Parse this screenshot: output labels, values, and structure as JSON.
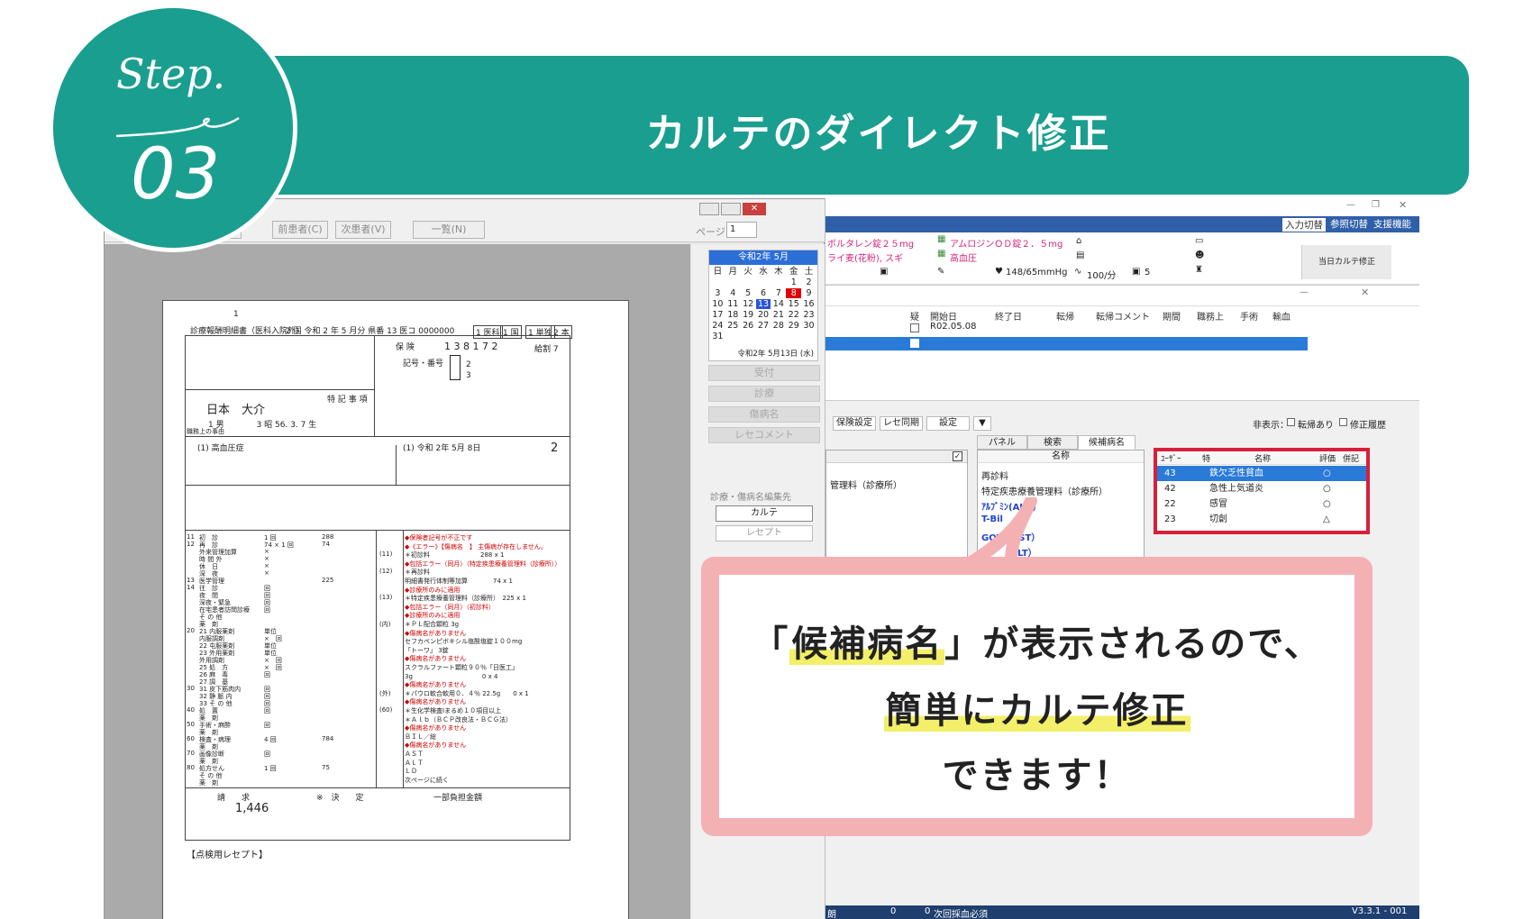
{
  "header": {
    "step_word": "Step.",
    "step_number": "03",
    "title": "カルテのダイレクト修正",
    "brand_color": "#1a9e8f"
  },
  "receipt_window": {
    "toolbar": {
      "back_button": "る",
      "prev_patient_button": "前患者(C)",
      "next_patient_button": "次患者(V)",
      "list_button": "一覧(N)",
      "page_label": "ページ",
      "page_value": "1"
    },
    "document": {
      "page_num": "1",
      "heading": "診療報酬明細書（医科入院外）",
      "era_date": "2 国  令和  2  年  5  月分  県番 13 医コ 0000000",
      "type_cells": [
        "1 医科",
        "1 国",
        "1 単独",
        "2 本"
      ],
      "insurer_label": "保 険",
      "insurer_number": "1  3  8  1  7  2",
      "benefit_ratio": "給割 7",
      "symbol_label": "記号・番号",
      "patient_name": "日本　大介",
      "patient_sex_birth": "1 男　　　　3 昭 56.  3.  7 生",
      "special_label": "特 記 事 項",
      "occupation_label": "職務上の事由",
      "disease_name": "(1) 高血圧症",
      "start_date": "(1) 令和  2年  5月  8日",
      "days": "2",
      "rows": [
        {
          "code": "11",
          "label": "初　診",
          "count": "1 回",
          "points": "288"
        },
        {
          "code": "12",
          "label": "再　診",
          "count": "74 ×  1 回",
          "points": "74"
        },
        {
          "code": "",
          "label": "外来管理加算",
          "count": "×",
          "points": ""
        },
        {
          "code": "",
          "label": "時 間 外",
          "count": "×",
          "points": ""
        },
        {
          "code": "",
          "label": "休　日",
          "count": "×",
          "points": ""
        },
        {
          "code": "",
          "label": "深　夜",
          "count": "×",
          "points": ""
        },
        {
          "code": "13",
          "label": "医学管理",
          "count": "",
          "points": "225"
        },
        {
          "code": "14",
          "label": "往　診",
          "count": "回",
          "points": ""
        },
        {
          "code": "",
          "label": "夜　間",
          "count": "回",
          "points": ""
        },
        {
          "code": "",
          "label": "深夜・緊急",
          "count": "回",
          "points": ""
        },
        {
          "code": "",
          "label": "在宅患者訪問診療",
          "count": "回",
          "points": ""
        },
        {
          "code": "",
          "label": "そ の 他",
          "count": "",
          "points": ""
        },
        {
          "code": "",
          "label": "薬　剤",
          "count": "",
          "points": ""
        },
        {
          "code": "20",
          "label": "21 内服薬剤",
          "count": "単位",
          "points": ""
        },
        {
          "code": "",
          "label": "内服調剤",
          "count": "×　回",
          "points": ""
        },
        {
          "code": "",
          "label": "22 屯服薬剤",
          "count": "単位",
          "points": ""
        },
        {
          "code": "",
          "label": "23 外用薬剤",
          "count": "単位",
          "points": ""
        },
        {
          "code": "",
          "label": "外用調剤",
          "count": "×　回",
          "points": ""
        },
        {
          "code": "",
          "label": "25 処　方",
          "count": "×　回",
          "points": ""
        },
        {
          "code": "",
          "label": "26 麻　毒",
          "count": "回",
          "points": ""
        },
        {
          "code": "",
          "label": "27 調　基",
          "count": "",
          "points": ""
        },
        {
          "code": "30",
          "label": "31 皮下筋肉内",
          "count": "回",
          "points": ""
        },
        {
          "code": "",
          "label": "32 静 脈 内",
          "count": "回",
          "points": ""
        },
        {
          "code": "",
          "label": "33 そ の 他",
          "count": "回",
          "points": ""
        },
        {
          "code": "40",
          "label": "処　置",
          "count": "回",
          "points": ""
        },
        {
          "code": "",
          "label": "薬　剤",
          "count": "",
          "points": ""
        },
        {
          "code": "50",
          "label": "手術・麻酔",
          "count": "回",
          "points": ""
        },
        {
          "code": "",
          "label": "薬　剤",
          "count": "",
          "points": ""
        },
        {
          "code": "60",
          "label": "検査・病理",
          "count": "4 回",
          "points": "784"
        },
        {
          "code": "",
          "label": "薬　剤",
          "count": "",
          "points": ""
        },
        {
          "code": "70",
          "label": "画像診断",
          "count": "回",
          "points": ""
        },
        {
          "code": "",
          "label": "薬　剤",
          "count": "",
          "points": ""
        },
        {
          "code": "80",
          "label": "処方せん",
          "count": "1 回",
          "points": "75"
        },
        {
          "code": "",
          "label": "そ の 他",
          "count": "",
          "points": ""
        },
        {
          "code": "",
          "label": "薬　剤",
          "count": "",
          "points": ""
        }
      ],
      "notes": [
        {
          "tag": "",
          "text": "◆保険者記号が不正です",
          "red": true
        },
        {
          "tag": "",
          "text": "◆《エラー》【傷病名　】 主傷病が存在しません。",
          "red": true
        },
        {
          "tag": "(11)",
          "text": "＊初診料　　　　　　　　288 x  1",
          "red": false
        },
        {
          "tag": "",
          "text": "◆包括エラー（同月）（特定疾患療養管理料（診療所））",
          "red": true
        },
        {
          "tag": "(12)",
          "text": "＊再診料",
          "red": false
        },
        {
          "tag": "",
          "text": "明細書発行体制等加算　　　　74 x  1",
          "red": false
        },
        {
          "tag": "",
          "text": "◆診療所のみに適用",
          "red": true
        },
        {
          "tag": "(13)",
          "text": "＊特定疾患療養管理料（診療所）　225 x  1",
          "red": false
        },
        {
          "tag": "",
          "text": "◆包括エラー（同月）（初診料）",
          "red": true
        },
        {
          "tag": "",
          "text": "◆診療所のみに適用",
          "red": true
        },
        {
          "tag": "(内)",
          "text": "＊ＰＬ配合顆粒 3g",
          "red": false
        },
        {
          "tag": "",
          "text": "◆傷病名がありません",
          "red": true
        },
        {
          "tag": "",
          "text": "セフカペンピボキシル塩酸塩錠１００mg",
          "red": false
        },
        {
          "tag": "",
          "text": "「トーワ」 3錠",
          "red": false
        },
        {
          "tag": "",
          "text": "◆傷病名がありません",
          "red": true
        },
        {
          "tag": "",
          "text": "スクラルファート顆粒９０％「日医工」",
          "red": false
        },
        {
          "tag": "",
          "text": "3g　　　　　　　　　　　0 x  4",
          "red": false
        },
        {
          "tag": "",
          "text": "◆傷病名がありません",
          "red": true
        },
        {
          "tag": "(外)",
          "text": "＊パウロ軟合軟用０．４％ 22.5g　　0 x  1",
          "red": false
        },
        {
          "tag": "",
          "text": "◆傷病名がありません",
          "red": true
        },
        {
          "tag": "(60)",
          "text": "＊生化学検査Ⅰまるめ１０項目以上",
          "red": false
        },
        {
          "tag": "",
          "text": "＊Ａｌｂ（ＢＣＰ改良法・ＢＣＧ法）",
          "red": false
        },
        {
          "tag": "",
          "text": "◆傷病名がありません",
          "red": true
        },
        {
          "tag": "",
          "text": "ＢＩＬ／総",
          "red": false
        },
        {
          "tag": "",
          "text": "◆傷病名がありません",
          "red": true
        },
        {
          "tag": "",
          "text": "ＡＳＴ",
          "red": false
        },
        {
          "tag": "",
          "text": "ＡＬＴ",
          "red": false
        },
        {
          "tag": "",
          "text": "ＬＤ",
          "red": false
        },
        {
          "tag": "",
          "text": "次ページに続く",
          "red": false
        }
      ],
      "total_label": "請　　求",
      "total_value": "1,446",
      "decision_label": "※　決　　定",
      "copay_label": "一部負担金額",
      "footer": "【点検用レセプト】"
    },
    "calendar": {
      "title": "令和2年 5月",
      "weekdays": [
        "日",
        "月",
        "火",
        "水",
        "木",
        "金",
        "土"
      ],
      "days": [
        "",
        "",
        "",
        "",
        "",
        "1",
        "2",
        "3",
        "4",
        "5",
        "6",
        "7",
        "8",
        "9",
        "10",
        "11",
        "12",
        "13",
        "14",
        "15",
        "16",
        "17",
        "18",
        "19",
        "20",
        "21",
        "22",
        "23",
        "24",
        "25",
        "26",
        "27",
        "28",
        "29",
        "30",
        "31"
      ],
      "selected_day": "13",
      "marked_day": "8",
      "today_label": "令和2年 5月13日 (水)"
    },
    "side_buttons": [
      "受付",
      "診療",
      "傷病名",
      "レセコメント"
    ],
    "edit_target": {
      "label": "診療・傷病名編集先",
      "karte_button": "カルテ",
      "rece_button": "レセプト"
    }
  },
  "karte_window": {
    "menu": [
      "入力切替",
      "参照切替",
      "支援機能"
    ],
    "info": {
      "drug1": "ボルタレン錠２５mg",
      "allergy": "ライ麦(花粉), スギ",
      "drug2": "アムロジンＯＤ錠２．５mg",
      "condition": "高血圧",
      "bp": "148/65mmHg",
      "pulse": "100/分",
      "count": "5",
      "side_button": "当日カルテ修正"
    },
    "disease_table": {
      "headers": [
        "疑",
        "開始日",
        "終了日",
        "転帰",
        "転帰コメント",
        "期間",
        "職務上",
        "手術",
        "輸血"
      ],
      "row_start": "R02.05.08"
    },
    "toolbar": {
      "buttons": [
        "保険設定",
        "レセ同期",
        "設定"
      ],
      "hidden_label": "非表示：",
      "check1": "転帰あり",
      "check2": "修正履歴"
    },
    "tabs": [
      "パネル",
      "検索",
      "候補病名"
    ],
    "left_list": [
      "管理料（診療所）"
    ],
    "middle_header": "名称",
    "middle_list": [
      {
        "text": "再診料",
        "blue": false
      },
      {
        "text": "特定疾患療養管理料（診療所）",
        "blue": false
      },
      {
        "text": "ｱﾙﾌﾞﾐﾝ(ALB)",
        "blue": true
      },
      {
        "text": "T-Bil",
        "blue": true
      },
      {
        "text": "GOT（AST）",
        "blue": true
      },
      {
        "text": "GPT（ALT）",
        "blue": true
      }
    ],
    "candidate": {
      "headers": [
        "ﾕｰｻﾞｰ",
        "特",
        "名称",
        "評価",
        "併記"
      ],
      "rows": [
        {
          "user": "43",
          "name": "鉄欠乏性貧血",
          "eval": "○"
        },
        {
          "user": "42",
          "name": "急性上気道炎",
          "eval": "○"
        },
        {
          "user": "22",
          "name": "感冒",
          "eval": "○"
        },
        {
          "user": "23",
          "name": "切創",
          "eval": "△"
        }
      ],
      "highlight_color": "#d71f3c"
    },
    "status": {
      "left": "朗",
      "n1": "0",
      "n2": "0",
      "message": "次回採血必須",
      "version": "V3.3.1 - 001"
    }
  },
  "callout": {
    "line1_pre": "「",
    "line1_hl": "候補病名",
    "line1_post": "」が表示されるので、",
    "line2": "簡単にカルテ修正",
    "line3": "できます！",
    "border_color": "#f4b1b4",
    "marker_color": "#f3ef6a"
  }
}
